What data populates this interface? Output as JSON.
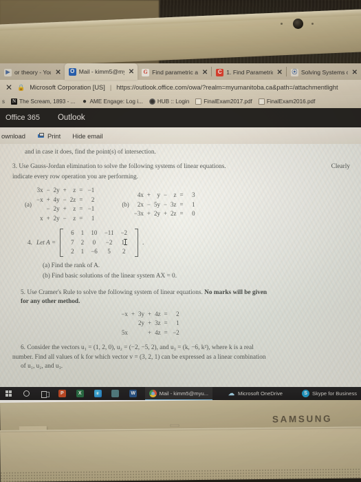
{
  "device": {
    "brand_label": "SAMSUNG",
    "webcam_icon": "webcam-lens"
  },
  "browser": {
    "tabs": [
      {
        "title": "or theory - You",
        "favicon": "youtube-favicon",
        "close_label": "✕",
        "active": false
      },
      {
        "title": "Mail - kimm5@my",
        "favicon": "outlook-favicon",
        "close_label": "✕",
        "active": true
      },
      {
        "title": "Find parametric ar",
        "favicon": "google-favicon",
        "close_label": "✕",
        "active": false
      },
      {
        "title": "1. Find Parametric",
        "favicon": "chegg-favicon",
        "close_label": "✕",
        "active": false
      },
      {
        "title": "Solving Systems o",
        "favicon": "generic-favicon",
        "close_label": "✕",
        "active": false
      }
    ],
    "address_bar": {
      "close_icon": "✕",
      "lock_icon": "🔒",
      "site_identity": "Microsoft Corporation [US]",
      "separator": "|",
      "url": "https://outlook.office.com/owa/?realm=myumanitoba.ca&path=/attachmentlight"
    },
    "bookmarks": [
      {
        "label": "The Scream, 1893 - ...",
        "icon": "netflix-icon"
      },
      {
        "label": "AME Engage: Log i...",
        "icon": "ame-icon"
      },
      {
        "label": "HUB :: Login",
        "icon": "hub-icon"
      },
      {
        "label": "FinalExam2017.pdf",
        "icon": "pdf-icon"
      },
      {
        "label": "FinalExam2016.pdf",
        "icon": "pdf-icon"
      }
    ],
    "bookmarks_overflow": "s"
  },
  "office": {
    "suite_label": "Office 365",
    "app_label": "Outlook"
  },
  "attachment_toolbar": {
    "download_label": "ownload",
    "print_label": "Print",
    "print_icon": "printer-icon",
    "hide_label": "Hide email"
  },
  "document": {
    "intro_line": "and in case it does, find the point(s) of intersection.",
    "q3": {
      "number": "3.",
      "text_line1": "Use Gauss-Jordan elimination to solve the following systems of linear equations.",
      "text_bold_tail": "Clearly",
      "text_line2": "indicate every row operation you are performing.",
      "system_a": {
        "label": "(a)",
        "rows": [
          [
            "3x",
            "−",
            "2y",
            "+",
            "z",
            "=",
            "−1"
          ],
          [
            "−x",
            "+",
            "4y",
            "−",
            "2z",
            "=",
            "2"
          ],
          [
            "",
            "−",
            "2y",
            "+",
            "z",
            "=",
            "−1"
          ],
          [
            "x",
            "+",
            "2y",
            "−",
            "z",
            "=",
            "1"
          ]
        ]
      },
      "system_b": {
        "label": "(b)",
        "rows": [
          [
            "4x",
            "+",
            "y",
            "−",
            "z",
            "=",
            "3"
          ],
          [
            "2x",
            "−",
            "5y",
            "−",
            "3z",
            "=",
            "1"
          ],
          [
            "−3x",
            "+",
            "2y",
            "+",
            "2z",
            "=",
            "0"
          ]
        ]
      }
    },
    "q4": {
      "number": "4.",
      "lead": "Let A =",
      "matrix": [
        [
          "6",
          "1",
          "10",
          "−11",
          "−2"
        ],
        [
          "7",
          "2",
          "0",
          "−2",
          "1"
        ],
        [
          "2",
          "1",
          "−6",
          "5",
          "2"
        ]
      ],
      "trailing_punct": ".",
      "parts": [
        "(a) Find the rank of A.",
        "(b) Find basic solutions of the linear system AX = 0."
      ]
    },
    "q5": {
      "number": "5.",
      "text": "Use Cramer's Rule to solve the following system of linear equations.",
      "bold_text1": "No marks will be given",
      "bold_text2": "for any other method.",
      "rows": [
        [
          "−x",
          "+",
          "3y",
          "+",
          "4z",
          "=",
          "2"
        ],
        [
          "",
          "",
          "2y",
          "+",
          "3z",
          "=",
          "1"
        ],
        [
          "5x",
          "",
          "",
          "+",
          "4z",
          "=",
          "−2"
        ]
      ]
    },
    "q6": {
      "number": "6.",
      "line1": "Consider the vectors u₁ = (1, 2, 0), u₂ = (−2, −5, 2), and u₃ = (k, −6, k²), where k is a real",
      "line2": "number. Find all values of k for which vector v = (3, 2, 1) can be expressed as a linear combination",
      "line3": "of u₁, u₂, and u₃."
    }
  },
  "taskbar": {
    "start_icon": "windows-start-icon",
    "cortana_icon": "cortana-search-icon",
    "taskview_icon": "task-view-icon",
    "pinned": [
      {
        "icon": "powerpoint-icon",
        "glyph": "P"
      },
      {
        "icon": "excel-icon",
        "glyph": "X"
      },
      {
        "icon": "edge-icon",
        "glyph": "e"
      },
      {
        "icon": "teams-icon",
        "glyph": ""
      },
      {
        "icon": "word-icon",
        "glyph": "W"
      }
    ],
    "tasks": [
      {
        "label": "Mail - kimm5@myu...",
        "icon": "chrome-icon"
      },
      {
        "label": "Microsoft OneDrive",
        "icon": "onedrive-icon"
      },
      {
        "label": "Skype for Business",
        "icon": "skype-icon"
      }
    ]
  }
}
